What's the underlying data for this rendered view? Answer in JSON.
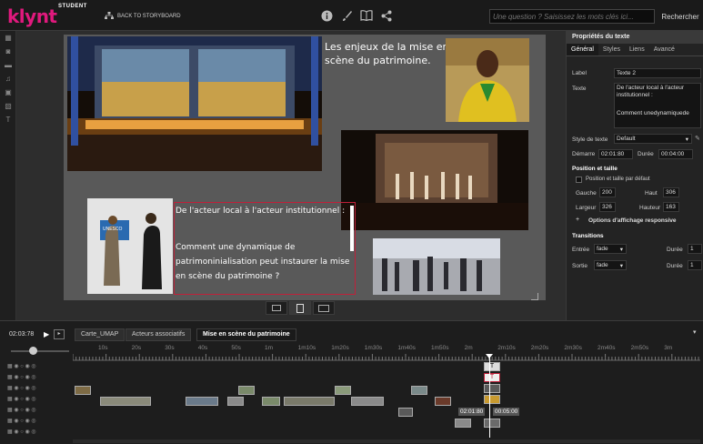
{
  "topbar": {
    "logo": "klynt",
    "logo_badge": "STUDENT",
    "back_label": "BACK TO STORYBOARD",
    "search_placeholder": "Une question ? Saisissez les mots clés ici...",
    "search_button": "Rechercher"
  },
  "slide": {
    "title_text": "Les enjeux de la mise en scène du patrimoine.",
    "subtitle_text": "De l'acteur local à l'acteur institutionnel :",
    "body_text": "Comment une dynamique de patrimoninialisation peut instaurer la mise en scène du patrimoine ?",
    "unesco_label": "UNESCO"
  },
  "panel": {
    "title": "Propriétés du texte",
    "tabs": [
      "Général",
      "Styles",
      "Liens",
      "Avancé"
    ],
    "label_label": "Label",
    "label_value": "Texte 2",
    "texte_label": "Texte",
    "texte_value_1": "De l'acteur local à l'acteur institutionnel :",
    "texte_value_2": "Comment unedynamiquede",
    "style_label": "Style de texte",
    "style_value": "Default",
    "demarre_label": "Démarre",
    "demarre_value": "02:01:80",
    "duree_label": "Durée",
    "duree_value": "00:04:00",
    "position_section": "Position et taille",
    "position_default": "Position et taille par défaut",
    "gauche_label": "Gauche",
    "gauche_value": "200",
    "haut_label": "Haut",
    "haut_value": "306",
    "largeur_label": "Largeur",
    "largeur_value": "326",
    "hauteur_label": "Hauteur",
    "hauteur_value": "163",
    "responsive_label": "Options d'affichage responsive",
    "transitions_section": "Transitions",
    "entree_label": "Entrée",
    "entree_value": "fade",
    "entree_duree_label": "Durée",
    "entree_duree_value": "1",
    "sortie_label": "Sortie",
    "sortie_value": "fade",
    "sortie_duree_label": "Durée",
    "sortie_duree_value": "1"
  },
  "timeline": {
    "timecode": "02:03:78",
    "tabs": [
      "Carte_UMAP",
      "Acteurs associatifs",
      "Mise en scène du patrimoine"
    ],
    "ruler": [
      "10s",
      "20s",
      "30s",
      "40s",
      "50s",
      "1m",
      "1m10s",
      "1m20s",
      "1m30s",
      "1m40s",
      "1m50s",
      "2m",
      "2m10s",
      "2m20s",
      "2m30s",
      "2m40s",
      "2m50s",
      "3m"
    ],
    "playhead_start": "02:01:80",
    "playhead_duration": "00:05:00"
  },
  "colors": {
    "brand": "#e0197d",
    "slide_bg": "#595959",
    "panel_bg": "#232323",
    "textbox_border": "#c0203a"
  }
}
